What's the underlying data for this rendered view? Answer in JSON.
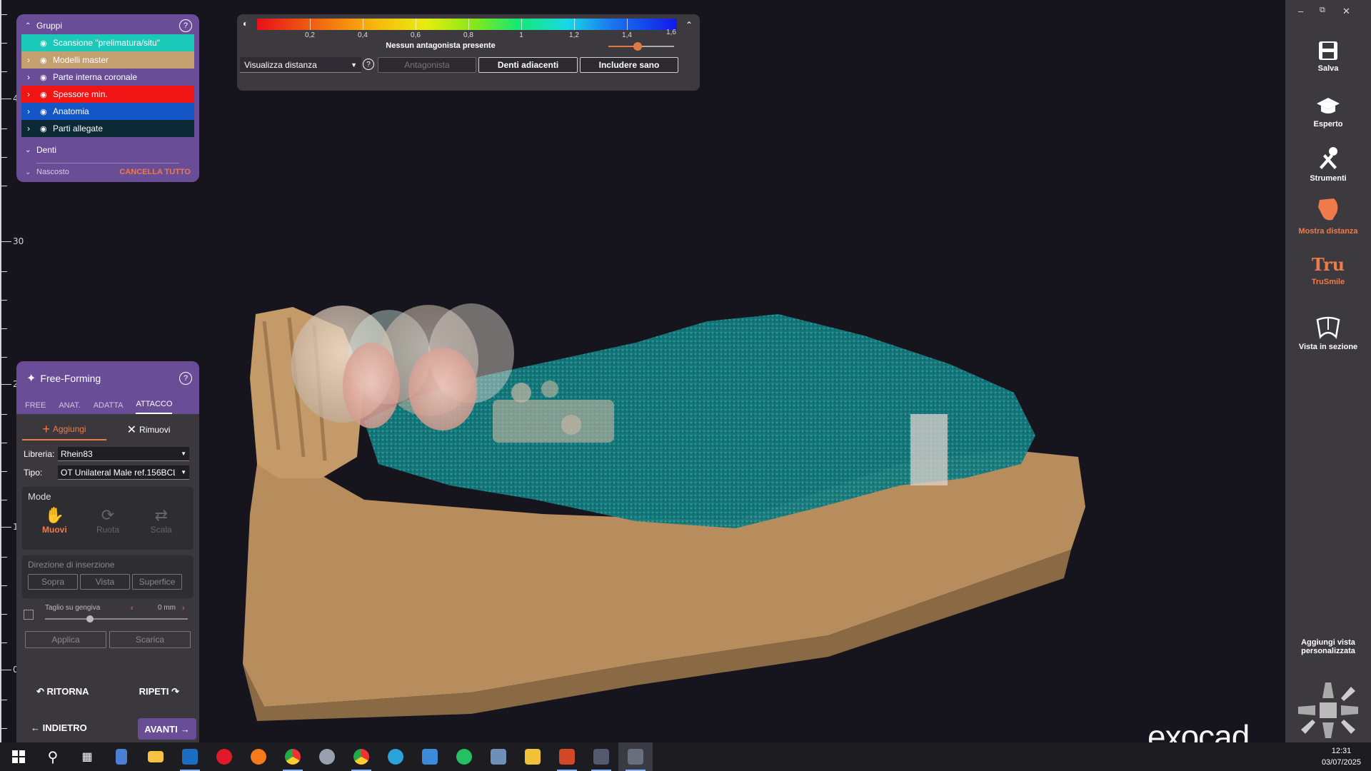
{
  "ruler": {
    "labels": [
      "4",
      "30",
      "2",
      "1",
      "0"
    ]
  },
  "groups": {
    "header": "Gruppi",
    "items": [
      {
        "label": "Scansione \"prelimatura/situ\"",
        "color": "#1ac9b8"
      },
      {
        "label": "Modelli master",
        "color": "#c4a070"
      },
      {
        "label": "Parte interna coronale",
        "color": "#6a4d97"
      },
      {
        "label": "Spessore min.",
        "color": "#f01414"
      },
      {
        "label": "Anatomia",
        "color": "#1456c6"
      },
      {
        "label": "Parti allegate",
        "color": "#0c2a36"
      }
    ],
    "teeth": "Denti",
    "hidden": "Nascosto",
    "clear_all": "CANCELLA TUTTO"
  },
  "colorbar": {
    "ticks": [
      "0,2",
      "0,4",
      "0,6",
      "0,8",
      "1",
      "1,2",
      "1,4",
      "1,6"
    ],
    "no_antagonist": "Nessun antagonista presente",
    "slider_value": 0.45,
    "view_select": "Visualizza distanza",
    "btn_antagonist": "Antagonista",
    "btn_adjacent": "Denti adiacenti",
    "btn_include": "Includere sano"
  },
  "freeforming": {
    "title": "Free-Forming",
    "tabs": [
      "FREE",
      "ANAT.",
      "ADATTA",
      "ATTACCO"
    ],
    "add": "Aggiungi",
    "remove": "Rimuovi",
    "library_label": "Libreria:",
    "library_value": "Rhein83",
    "type_label": "Tipo:",
    "type_value": "OT Unilateral Male ref.156BCL",
    "mode_label": "Mode",
    "mode_move": "Muovi",
    "mode_rotate": "Ruota",
    "mode_scale": "Scala",
    "insertion_label": "Direzione di inserzione",
    "ins_above": "Sopra",
    "ins_view": "Vista",
    "ins_surface": "Superfice",
    "gum_cut": "Taglio su gengiva",
    "gum_value": "0 mm",
    "apply": "Applica",
    "discard": "Scarica",
    "undo": "RITORNA",
    "redo": "RIPETI",
    "back": "INDIETRO",
    "next": "AVANTI"
  },
  "sidebar": {
    "items": [
      {
        "label": "Salva",
        "icon": "floppy-icon"
      },
      {
        "label": "Esperto",
        "icon": "graduation-cap-icon"
      },
      {
        "label": "Strumenti",
        "icon": "tools-icon"
      },
      {
        "label": "Mostra distanza",
        "icon": "tooth-distance-icon"
      },
      {
        "label": "TruSmile",
        "icon": "trusmile-icon"
      },
      {
        "label": "Vista in sezione",
        "icon": "section-view-icon"
      }
    ],
    "add_view": "Aggiungi vista personalizzata"
  },
  "logo": "exocad",
  "clock": {
    "time": "12:31",
    "date": "03/07/2025"
  },
  "colors": {
    "accent": "#f07a4a",
    "panel_purple": "#6a4d97",
    "model_tan": "#b88d5e",
    "scan_teal": "#1a9c9c"
  }
}
